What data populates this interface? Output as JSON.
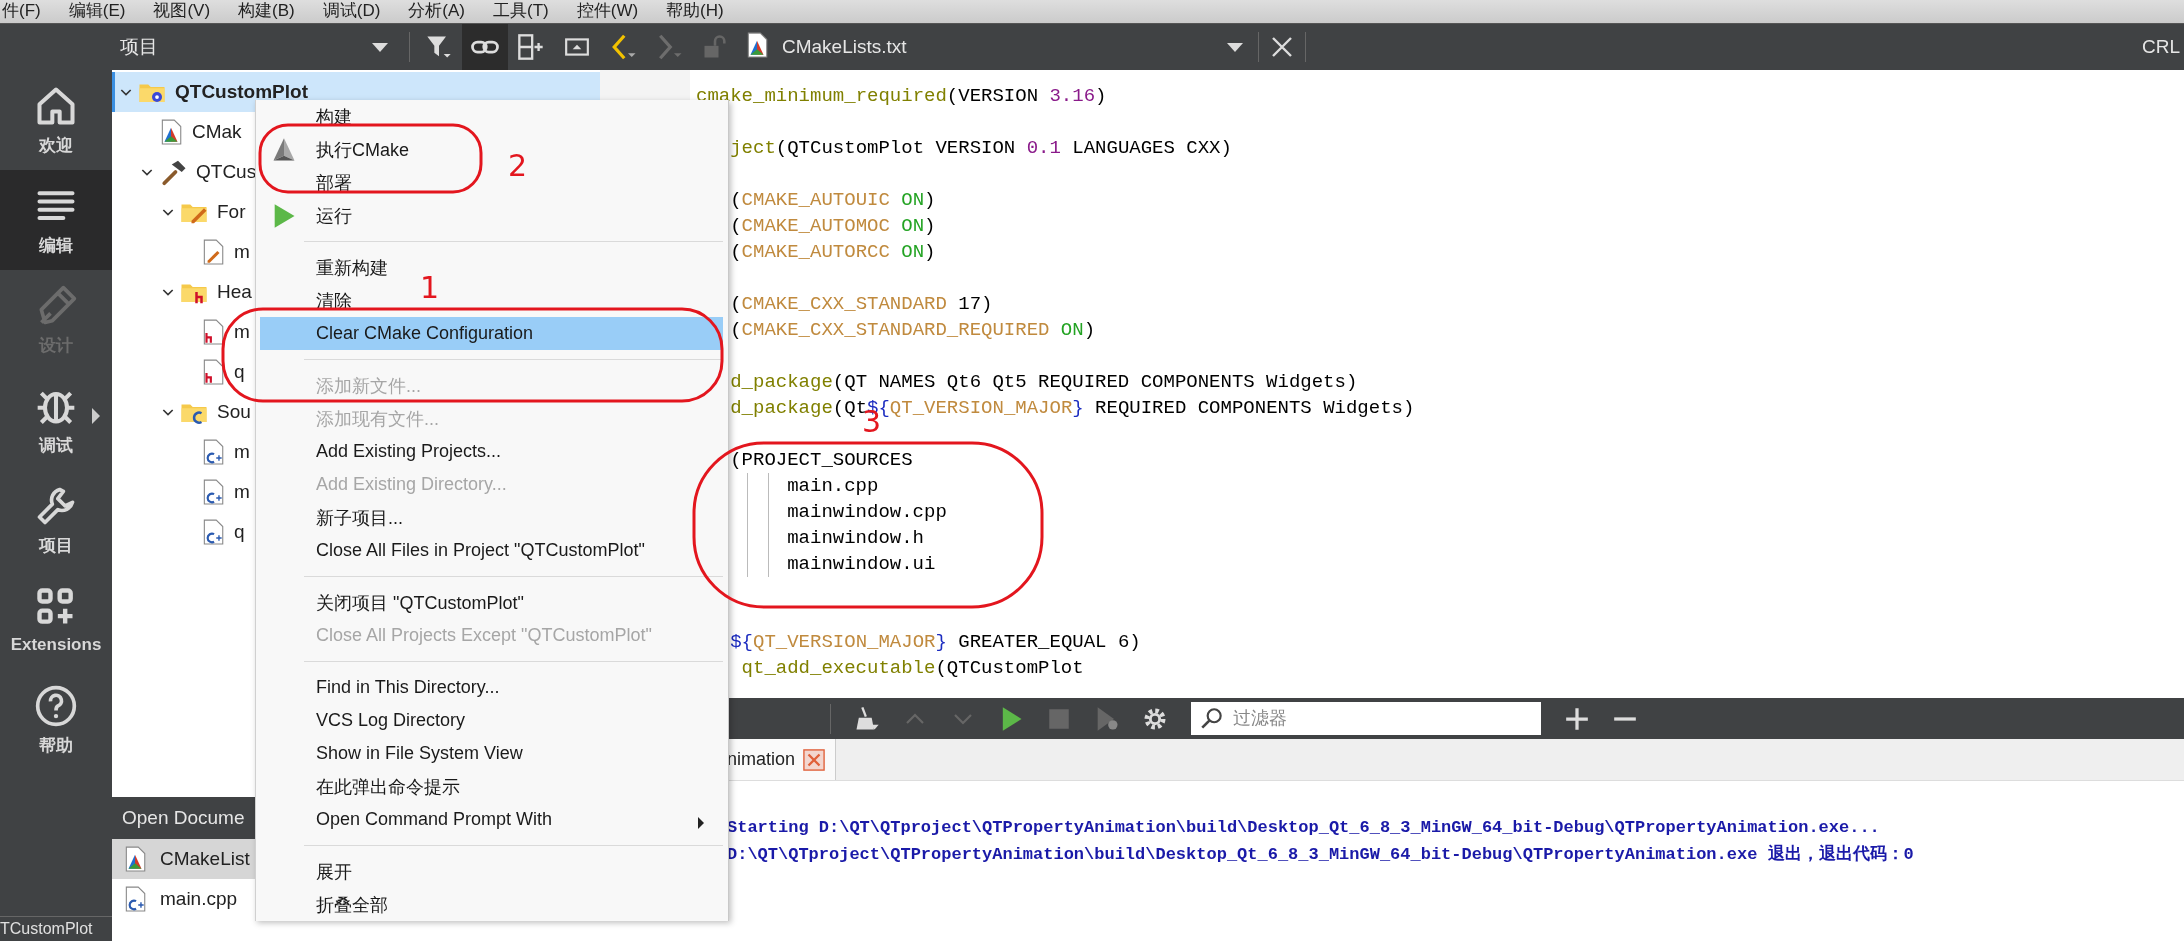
{
  "menu_bar": [
    "件(F)",
    "编辑(E)",
    "视图(V)",
    "构建(B)",
    "调试(D)",
    "分析(A)",
    "工具(T)",
    "控件(W)",
    "帮助(H)"
  ],
  "mode_sidebar": [
    {
      "kind": "welcome",
      "label": "欢迎",
      "selected": false,
      "disabled": false,
      "submenu": false
    },
    {
      "kind": "edit",
      "label": "编辑",
      "selected": true,
      "disabled": false,
      "submenu": false
    },
    {
      "kind": "design",
      "label": "设计",
      "selected": false,
      "disabled": true,
      "submenu": false
    },
    {
      "kind": "debug",
      "label": "调试",
      "selected": false,
      "disabled": false,
      "submenu": true
    },
    {
      "kind": "projects",
      "label": "项目",
      "selected": false,
      "disabled": false,
      "submenu": false
    },
    {
      "kind": "extensions",
      "label": "Extensions",
      "selected": false,
      "disabled": false,
      "submenu": false
    },
    {
      "kind": "help",
      "label": "帮助",
      "selected": false,
      "disabled": false,
      "submenu": false
    }
  ],
  "status_bar": {
    "text": "TCustomPlot"
  },
  "project_panel": {
    "title": "项目",
    "tree": [
      {
        "kind": "project",
        "label": "QTCustomPlot",
        "selected": true,
        "expanded": true,
        "children": [
          {
            "kind": "cmake",
            "label": "CMak",
            "selected": false
          },
          {
            "kind": "target",
            "label": "QTCus",
            "selected": false,
            "expanded": true,
            "children": [
              {
                "kind": "forms",
                "label": "For",
                "selected": false,
                "expanded": true,
                "children": [
                  {
                    "kind": "form",
                    "label": "m",
                    "selected": false
                  }
                ]
              },
              {
                "kind": "headers",
                "label": "Hea",
                "selected": false,
                "expanded": true,
                "children": [
                  {
                    "kind": "header",
                    "label": "m",
                    "selected": false
                  },
                  {
                    "kind": "header",
                    "label": "q",
                    "selected": false
                  }
                ]
              },
              {
                "kind": "sources",
                "label": "Sou",
                "selected": false,
                "expanded": true,
                "children": [
                  {
                    "kind": "source",
                    "label": "m",
                    "selected": false
                  },
                  {
                    "kind": "source",
                    "label": "m",
                    "selected": false
                  },
                  {
                    "kind": "source",
                    "label": "q",
                    "selected": false
                  }
                ]
              }
            ]
          }
        ]
      }
    ]
  },
  "open_documents": {
    "title": "Open Docume",
    "items": [
      {
        "kind": "cmake",
        "label": "CMakeList",
        "selected": true
      },
      {
        "kind": "source",
        "label": "main.cpp",
        "selected": false
      }
    ]
  },
  "editor": {
    "file_name": "CMakeLists.txt",
    "line_ending": "CRL",
    "lines": [
      {
        "kind": "whole",
        "segments": [
          {
            "kind": "fn",
            "text": "cmake_minimum_required"
          },
          {
            "kind": "plain",
            "text": "(VERSION "
          },
          {
            "kind": "num",
            "text": "3.16"
          },
          {
            "kind": "plain",
            "text": ")"
          }
        ]
      },
      {
        "kind": "blank"
      },
      {
        "kind": "partial",
        "segments": [
          {
            "kind": "fn",
            "text": "ject"
          },
          {
            "kind": "plain",
            "text": "(QTCustomPlot VERSION "
          },
          {
            "kind": "num",
            "text": "0.1"
          },
          {
            "kind": "plain",
            "text": " LANGUAGES CXX)"
          }
        ]
      },
      {
        "kind": "blank"
      },
      {
        "kind": "partial",
        "segments": [
          {
            "kind": "plain",
            "text": "("
          },
          {
            "kind": "var",
            "text": "CMAKE_AUTOUIC"
          },
          {
            "kind": "on",
            "text": " ON"
          },
          {
            "kind": "plain",
            "text": ")"
          }
        ]
      },
      {
        "kind": "partial",
        "segments": [
          {
            "kind": "plain",
            "text": "("
          },
          {
            "kind": "var",
            "text": "CMAKE_AUTOMOC"
          },
          {
            "kind": "on",
            "text": " ON"
          },
          {
            "kind": "plain",
            "text": ")"
          }
        ]
      },
      {
        "kind": "partial",
        "segments": [
          {
            "kind": "plain",
            "text": "("
          },
          {
            "kind": "var",
            "text": "CMAKE_AUTORCC"
          },
          {
            "kind": "on",
            "text": " ON"
          },
          {
            "kind": "plain",
            "text": ")"
          }
        ]
      },
      {
        "kind": "blank"
      },
      {
        "kind": "partial",
        "segments": [
          {
            "kind": "plain",
            "text": "("
          },
          {
            "kind": "var",
            "text": "CMAKE_CXX_STANDARD"
          },
          {
            "kind": "plain",
            "text": " 17)"
          }
        ]
      },
      {
        "kind": "partial",
        "segments": [
          {
            "kind": "plain",
            "text": "("
          },
          {
            "kind": "var",
            "text": "CMAKE_CXX_STANDARD_REQUIRED"
          },
          {
            "kind": "on",
            "text": " ON"
          },
          {
            "kind": "plain",
            "text": ")"
          }
        ]
      },
      {
        "kind": "blank"
      },
      {
        "kind": "partial",
        "segments": [
          {
            "kind": "fn",
            "text": "d_package"
          },
          {
            "kind": "plain",
            "text": "(QT NAMES Qt6 Qt5 REQUIRED COMPONENTS Widgets)"
          }
        ]
      },
      {
        "kind": "partial",
        "segments": [
          {
            "kind": "fn",
            "text": "d_package"
          },
          {
            "kind": "plain",
            "text": "(Qt"
          },
          {
            "kind": "brace",
            "text": "${"
          },
          {
            "kind": "var",
            "text": "QT_VERSION_MAJOR"
          },
          {
            "kind": "brace",
            "text": "}"
          },
          {
            "kind": "plain",
            "text": " REQUIRED COMPONENTS Widgets)"
          }
        ]
      },
      {
        "kind": "blank"
      },
      {
        "kind": "partial",
        "segments": [
          {
            "kind": "plain",
            "text": "(PROJECT_SOURCES"
          }
        ]
      },
      {
        "kind": "nested",
        "segments": [
          {
            "kind": "plain",
            "text": "main.cpp"
          }
        ]
      },
      {
        "kind": "nested",
        "segments": [
          {
            "kind": "plain",
            "text": "mainwindow.cpp"
          }
        ]
      },
      {
        "kind": "nested",
        "segments": [
          {
            "kind": "plain",
            "text": "mainwindow.h"
          }
        ]
      },
      {
        "kind": "nested",
        "segments": [
          {
            "kind": "plain",
            "text": "mainwindow.ui"
          }
        ]
      },
      {
        "kind": "blank"
      },
      {
        "kind": "blank"
      },
      {
        "kind": "partial",
        "segments": [
          {
            "kind": "brace",
            "text": "${"
          },
          {
            "kind": "var",
            "text": "QT_VERSION_MAJOR"
          },
          {
            "kind": "brace",
            "text": "}"
          },
          {
            "kind": "plain",
            "text": " GREATER_EQUAL 6)"
          }
        ]
      },
      {
        "kind": "indented",
        "segments": [
          {
            "kind": "fn",
            "text": "qt_add_executable"
          },
          {
            "kind": "plain",
            "text": "(QTCustomPlot"
          }
        ]
      }
    ]
  },
  "output_panel": {
    "filter": {
      "placeholder": "过滤器"
    },
    "tabs": [
      {
        "label": "nimation",
        "selected": true
      }
    ],
    "lines": [
      "Starting D:\\QT\\QTproject\\QTPropertyAnimation\\build\\Desktop_Qt_6_8_3_MinGW_64_bit-Debug\\QTPropertyAnimation.exe...",
      "D:\\QT\\QTproject\\QTPropertyAnimation\\build\\Desktop_Qt_6_8_3_MinGW_64_bit-Debug\\QTPropertyAnimation.exe 退出，退出代码：0"
    ]
  },
  "context_menu": [
    {
      "kind": "item",
      "label": "构建",
      "disabled": false,
      "selected": false,
      "submenu": false
    },
    {
      "kind": "cmake",
      "label": "执行CMake",
      "disabled": false,
      "selected": false,
      "submenu": false
    },
    {
      "kind": "item",
      "label": "部署",
      "disabled": false,
      "selected": false,
      "submenu": false
    },
    {
      "kind": "run",
      "label": "运行",
      "disabled": false,
      "selected": false,
      "submenu": false
    },
    {
      "kind": "separator"
    },
    {
      "kind": "item",
      "label": "重新构建",
      "disabled": false,
      "selected": false,
      "submenu": false
    },
    {
      "kind": "item",
      "label": "清除",
      "disabled": false,
      "selected": false,
      "submenu": false
    },
    {
      "kind": "item",
      "label": "Clear CMake Configuration",
      "disabled": false,
      "selected": true,
      "submenu": false
    },
    {
      "kind": "separator"
    },
    {
      "kind": "item",
      "label": "添加新文件...",
      "disabled": true,
      "selected": false,
      "submenu": false
    },
    {
      "kind": "item",
      "label": "添加现有文件...",
      "disabled": true,
      "selected": false,
      "submenu": false
    },
    {
      "kind": "item",
      "label": "Add Existing Projects...",
      "disabled": false,
      "selected": false,
      "submenu": false
    },
    {
      "kind": "item",
      "label": "Add Existing Directory...",
      "disabled": true,
      "selected": false,
      "submenu": false
    },
    {
      "kind": "item",
      "label": "新子项目...",
      "disabled": false,
      "selected": false,
      "submenu": false
    },
    {
      "kind": "item",
      "label": "Close All Files in Project \"QTCustomPlot\"",
      "disabled": false,
      "selected": false,
      "submenu": false
    },
    {
      "kind": "separator"
    },
    {
      "kind": "item",
      "label": "关闭项目 \"QTCustomPlot\"",
      "disabled": false,
      "selected": false,
      "submenu": false
    },
    {
      "kind": "item",
      "label": "Close All Projects Except \"QTCustomPlot\"",
      "disabled": true,
      "selected": false,
      "submenu": false
    },
    {
      "kind": "separator"
    },
    {
      "kind": "item",
      "label": "Find in This Directory...",
      "disabled": false,
      "selected": false,
      "submenu": false
    },
    {
      "kind": "item",
      "label": "VCS Log Directory",
      "disabled": false,
      "selected": false,
      "submenu": false
    },
    {
      "kind": "item",
      "label": "Show in File System View",
      "disabled": false,
      "selected": false,
      "submenu": false
    },
    {
      "kind": "item",
      "label": "在此弹出命令提示",
      "disabled": false,
      "selected": false,
      "submenu": false
    },
    {
      "kind": "item",
      "label": "Open Command Prompt With",
      "disabled": false,
      "selected": false,
      "submenu": true
    },
    {
      "kind": "separator"
    },
    {
      "kind": "item",
      "label": "展开",
      "disabled": false,
      "selected": false,
      "submenu": false
    },
    {
      "kind": "item",
      "label": "折叠全部",
      "disabled": false,
      "selected": false,
      "submenu": false
    }
  ],
  "annotations": [
    {
      "number": "2"
    },
    {
      "number": "1"
    },
    {
      "number": "3"
    }
  ]
}
